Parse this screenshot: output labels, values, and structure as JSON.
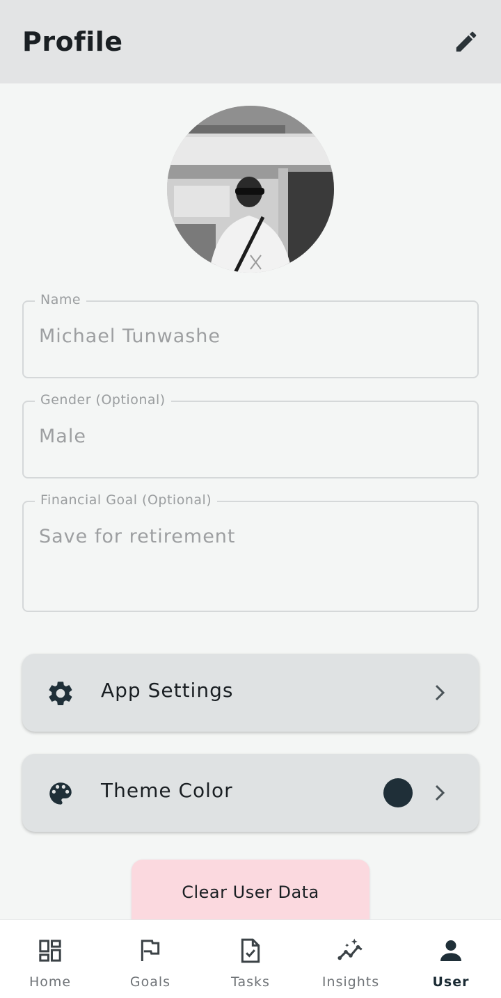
{
  "header": {
    "title": "Profile",
    "edit_icon": "pencil-icon"
  },
  "avatar": {
    "alt": "Profile photo"
  },
  "fields": {
    "name": {
      "label": "Name",
      "value": "Michael Tunwashe"
    },
    "gender": {
      "label": "Gender (Optional)",
      "value": "Male"
    },
    "goal": {
      "label": "Financial Goal (Optional)",
      "value": "Save for retirement"
    }
  },
  "settings_card": {
    "label": "App Settings",
    "icon": "gear-icon"
  },
  "theme_card": {
    "label": "Theme Color",
    "icon": "palette-icon",
    "swatch_color": "#1f2f38"
  },
  "clear_button": {
    "label": "Clear User Data",
    "color": "#fbd9df"
  },
  "nav": {
    "items": [
      {
        "label": "Home",
        "icon": "dashboard-icon"
      },
      {
        "label": "Goals",
        "icon": "flag-icon"
      },
      {
        "label": "Tasks",
        "icon": "task-icon"
      },
      {
        "label": "Insights",
        "icon": "insights-icon"
      },
      {
        "label": "User",
        "icon": "person-icon",
        "active": true
      }
    ]
  },
  "colors": {
    "accent": "#1f2f38",
    "header_bg": "#e3e4e5",
    "page_bg": "#f4f6f5"
  }
}
